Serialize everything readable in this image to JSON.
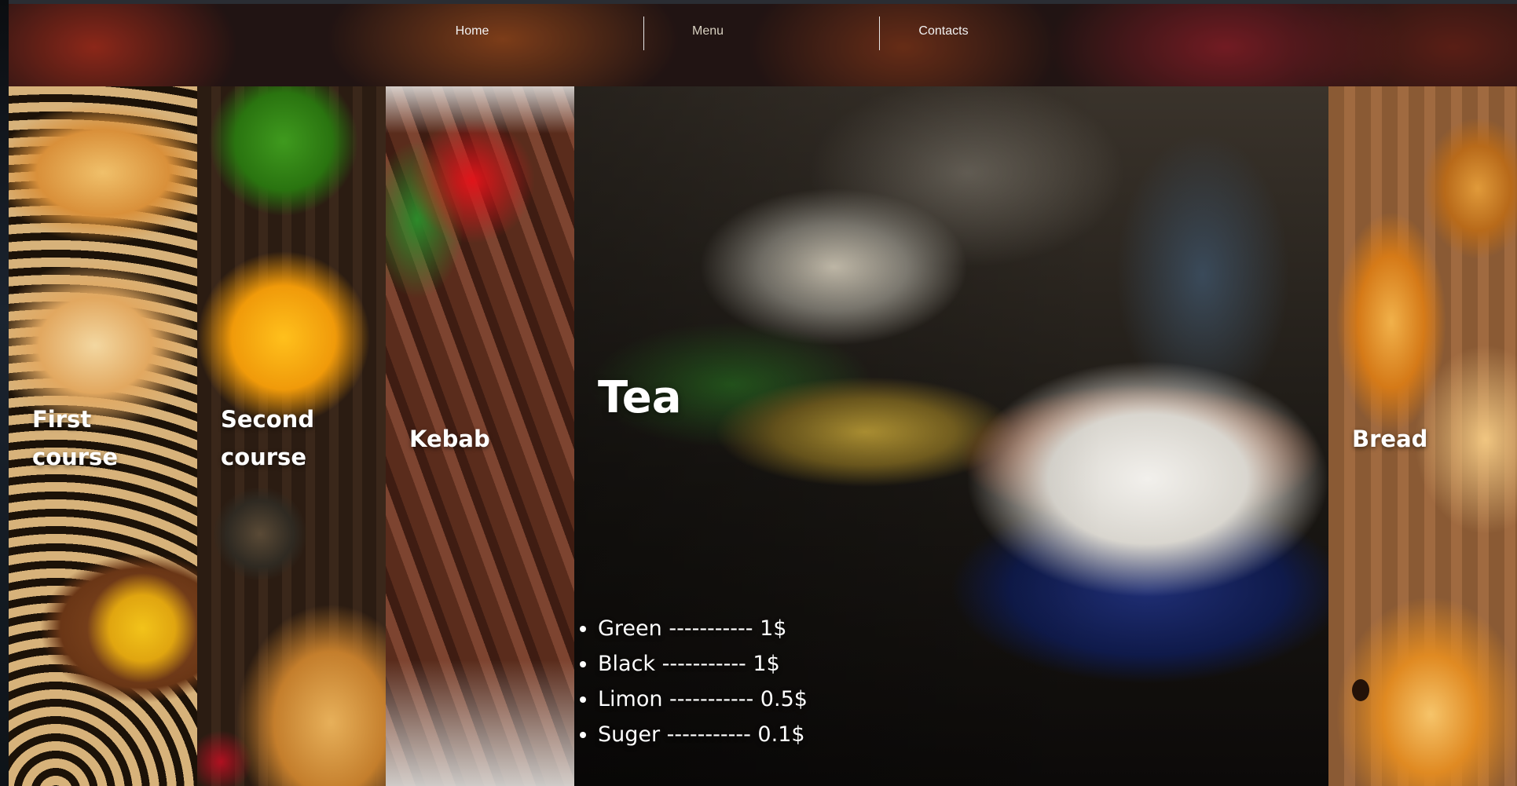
{
  "nav": {
    "items": [
      {
        "label": "Home",
        "active": false
      },
      {
        "label": "Menu",
        "active": true
      },
      {
        "label": "Contacts",
        "active": false
      }
    ]
  },
  "panels": {
    "first": {
      "label": "First course"
    },
    "second": {
      "label": "Second course"
    },
    "kebab": {
      "label": "Kebab"
    },
    "tea": {
      "title": "Tea",
      "prices": [
        "Green ----------- 1$",
        "Black ----------- 1$",
        "Limon ----------- 0.5$",
        "Suger ----------- 0.1$"
      ]
    },
    "bread": {
      "label": "Bread"
    }
  },
  "colors": {
    "nav_text": "#f2f2f2",
    "panel_text": "#ffffff",
    "separator": "#e8e8e8"
  }
}
